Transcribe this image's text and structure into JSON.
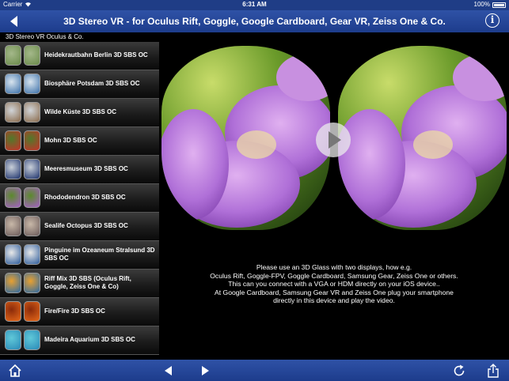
{
  "status_bar": {
    "carrier": "Carrier",
    "time": "6:31 AM",
    "battery": "100%"
  },
  "nav": {
    "title": "3D Stereo VR - for Oculus Rift, Goggle, Google Cardboard, Gear VR, Zeiss One & Co.",
    "info_label": "i"
  },
  "sidebar": {
    "header": "3D Stereo VR Oculus & Co.",
    "items": [
      {
        "label": "Heidekrautbahn Berlin 3D SBS OC",
        "colors": [
          "#6a8a4a",
          "#a4b88a"
        ]
      },
      {
        "label": "Biosphäre Potsdam 3D SBS OC",
        "colors": [
          "#3a6fa8",
          "#d8e4ee"
        ]
      },
      {
        "label": "Wilde Küste 3D SBS OC",
        "colors": [
          "#8a6a4a",
          "#d0d4d8"
        ]
      },
      {
        "label": "Mohn 3D SBS OC",
        "colors": [
          "#c8302a",
          "#4f7a2a"
        ]
      },
      {
        "label": "Meeresmuseum 3D SBS OC",
        "colors": [
          "#1a2f6a",
          "#c8cfd8"
        ]
      },
      {
        "label": "Rhododendron 3D SBS OC",
        "colors": [
          "#a660c8",
          "#5a8a2a"
        ]
      },
      {
        "label": "Sealife Octopus 3D SBS OC",
        "colors": [
          "#6a5a5a",
          "#c8b8a8"
        ]
      },
      {
        "label": "Pinguine im Ozeaneum Stralsund 3D SBS OC",
        "colors": [
          "#2a5a9a",
          "#e8e8e8"
        ]
      },
      {
        "label": "Riff Mix 3D SBS (Oculus Rift, Goggle, Zeiss One & Co)",
        "colors": [
          "#2a6aa8",
          "#e8a030"
        ]
      },
      {
        "label": "Fire/Fire 3D SBS OC",
        "colors": [
          "#e86a1a",
          "#8a2a0a"
        ]
      },
      {
        "label": "Madeira Aquarium 3D SBS OC",
        "colors": [
          "#2a8ab8",
          "#60c8d8"
        ]
      }
    ]
  },
  "content": {
    "info_lines": [
      "Please use an 3D Glass with two displays, how e.g.",
      "Oculus Rift, Goggle-FPV, Goggle Cardboard, Samsung Gear, Zeiss One or others.",
      "This can you connect with a VGA or HDM directly on your iOS device..",
      "At Google Cardboard, Samsung Gear VR and Zeiss One plug your smartphone",
      "directly in this device and play the video."
    ]
  },
  "toolbar": {
    "icons": [
      "home-icon",
      "previous-icon",
      "next-icon",
      "refresh-icon",
      "share-icon"
    ]
  }
}
